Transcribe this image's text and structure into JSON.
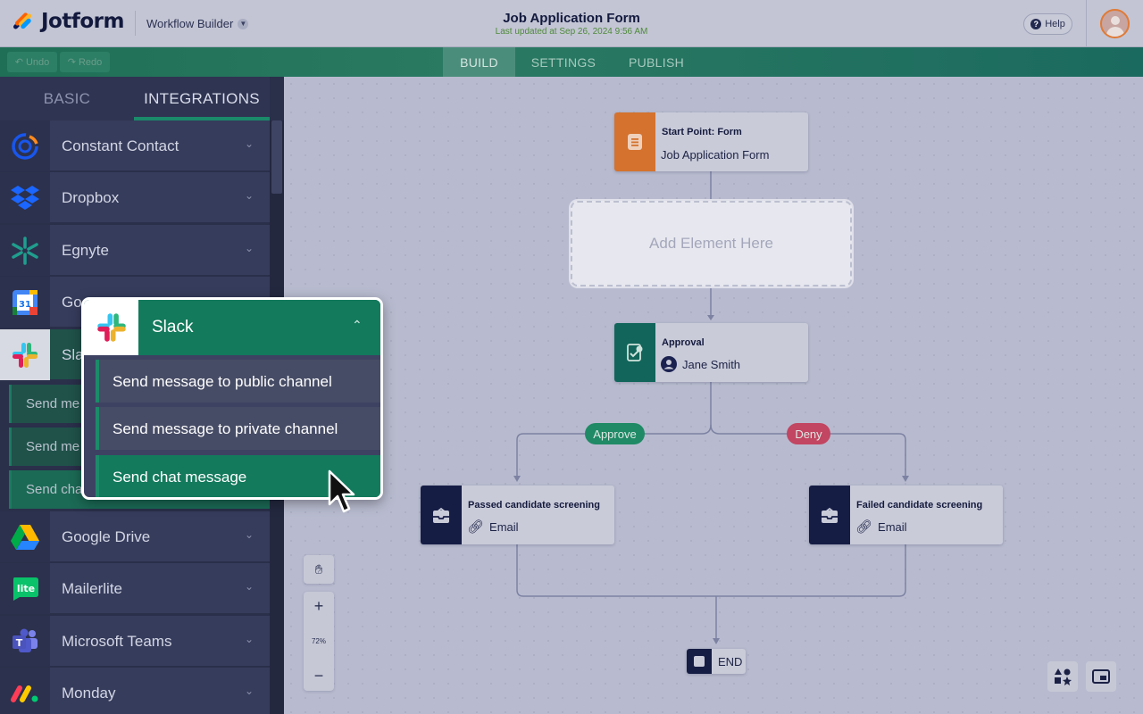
{
  "header": {
    "logo_text": "Jotform",
    "workflow_builder": "Workflow Builder",
    "form_title": "Job Application Form",
    "last_updated": "Last updated at Sep 26, 2024 9:56 AM",
    "help_label": "Help"
  },
  "toolbar": {
    "undo_label": "Undo",
    "redo_label": "Redo",
    "tabs": [
      "BUILD",
      "SETTINGS",
      "PUBLISH"
    ],
    "active_tab": "BUILD"
  },
  "left_panel": {
    "tabs": [
      "BASIC",
      "INTEGRATIONS"
    ],
    "active_tab": "INTEGRATIONS",
    "integrations": [
      {
        "label": "Constant Contact",
        "icon": "constant-contact-icon"
      },
      {
        "label": "Dropbox",
        "icon": "dropbox-icon"
      },
      {
        "label": "Egnyte",
        "icon": "egnyte-icon"
      },
      {
        "label": "Go",
        "icon": "google-calendar-icon"
      },
      {
        "label": "Sla",
        "icon": "slack-icon"
      },
      {
        "label": "Google Drive",
        "icon": "google-drive-icon"
      },
      {
        "label": "Mailerlite",
        "icon": "mailerlite-icon"
      },
      {
        "label": "Microsoft Teams",
        "icon": "microsoft-teams-icon"
      },
      {
        "label": "Monday",
        "icon": "monday-icon"
      }
    ],
    "sub_items": [
      "Send me",
      "Send me",
      "Send cha"
    ]
  },
  "slack_popup": {
    "title": "Slack",
    "items": [
      "Send message to public channel",
      "Send message to private channel",
      "Send chat message"
    ],
    "active_item": "Send chat message"
  },
  "canvas": {
    "start_node": {
      "title": "Start Point: Form",
      "subtitle": "Job Application Form"
    },
    "add_element": "Add Element Here",
    "approval_node": {
      "title": "Approval",
      "assignee": "Jane Smith"
    },
    "approve_label": "Approve",
    "deny_label": "Deny",
    "passed_node": {
      "title": "Passed candidate screening",
      "subtitle": "Email"
    },
    "failed_node": {
      "title": "Failed candidate screening",
      "subtitle": "Email"
    },
    "end_label": "END",
    "zoom_level": "72%",
    "zoom_in": "+",
    "zoom_out": "−"
  },
  "colors": {
    "toolbar_green": "#1f6f57",
    "approve_green": "#1f8a65",
    "deny_red": "#c24561",
    "form_orange": "#d4722e",
    "approval_teal": "#11655a",
    "email_navy": "#161d45"
  }
}
